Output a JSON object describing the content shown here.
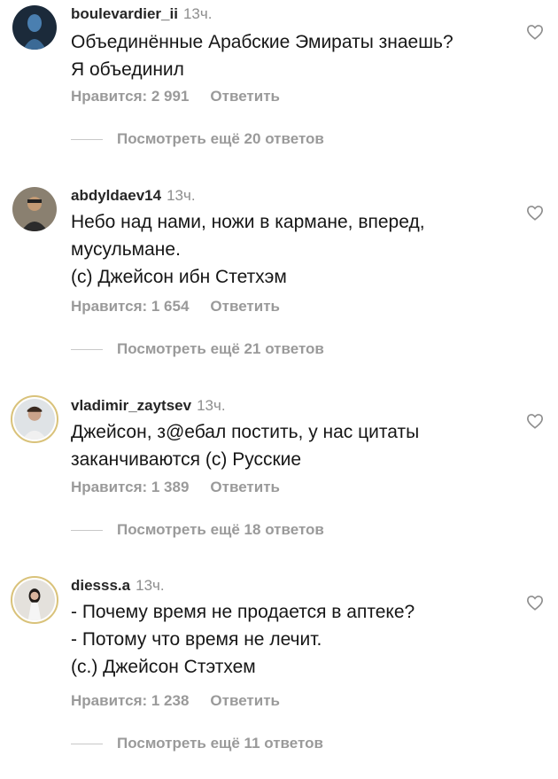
{
  "comments": [
    {
      "username": "boulevardier_ii",
      "time": "13ч.",
      "lines": [
        "Объединённые Арабские Эмираты знаешь?",
        "Я объединил"
      ],
      "likes": "Нравится: 2 991",
      "reply": "Ответить",
      "view_replies": "Посмотреть ещё 20 ответов"
    },
    {
      "username": "abdyldaev14",
      "time": "13ч.",
      "lines": [
        "Небо над нами, ножи в кармане, вперед,",
        "мусульмане.",
        "(с) Джейсон ибн Стетхэм"
      ],
      "likes": "Нравится: 1 654",
      "reply": "Ответить",
      "view_replies": "Посмотреть ещё 21 ответов"
    },
    {
      "username": "vladimir_zaytsev",
      "time": "13ч.",
      "lines": [
        "Джейсон, з@ебал постить, у нас цитаты",
        "заканчиваются (с) Русские"
      ],
      "likes": "Нравится: 1 389",
      "reply": "Ответить",
      "view_replies": "Посмотреть ещё 18 ответов"
    },
    {
      "username": "diesss.a",
      "time": "13ч.",
      "lines": [
        "- Почему время не продается в аптеке?",
        "- Потому что время не лечит.",
        "(с.) Джейсон Стэтхем"
      ],
      "likes": "Нравится: 1 238",
      "reply": "Ответить",
      "view_replies": "Посмотреть ещё 11 ответов"
    }
  ],
  "colors": {
    "username": "#262626",
    "secondary": "#9a9a9a",
    "story_ring": "#d9c27a"
  }
}
